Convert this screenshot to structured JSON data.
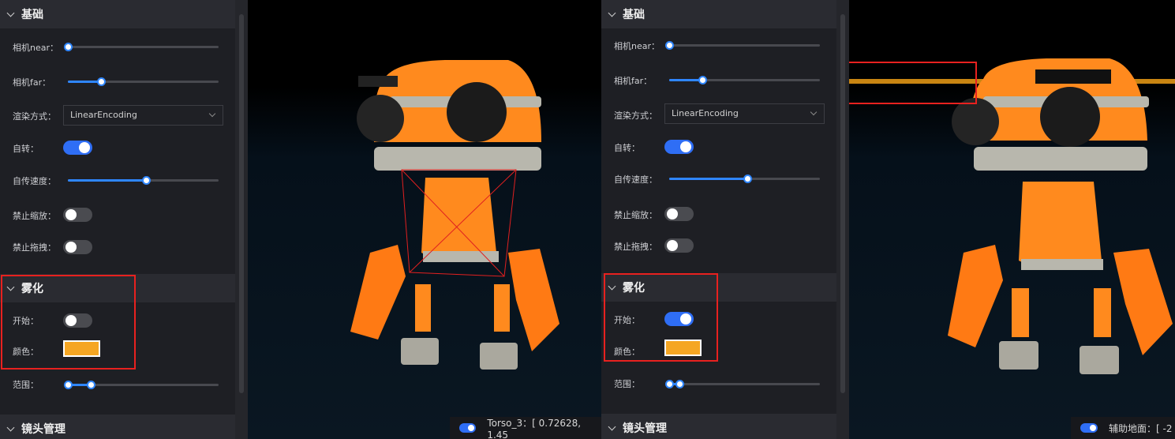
{
  "colors": {
    "accent": "#2f86ff",
    "fog": "#f5a623",
    "highlight": "#e8211f",
    "robot": "#ff8a1e"
  },
  "left": {
    "sections": {
      "basic": "基础",
      "fog": "雾化",
      "camera": "镜头管理"
    },
    "labels": {
      "near": "相机near：",
      "far": "相机far：",
      "render": "渲染方式：",
      "rotate": "自转：",
      "speed": "自传速度：",
      "zoom": "禁止缩放：",
      "drag": "禁止拖拽：",
      "fogStart": "开始：",
      "fogColor": "颜色：",
      "fogRange": "范围："
    },
    "render_value": "LinearEncoding",
    "sliders": {
      "near": 0.0,
      "far": 0.22,
      "speed": 0.52,
      "range": [
        0.0,
        0.15
      ]
    },
    "toggles": {
      "rotate": true,
      "zoom": false,
      "drag": false,
      "fogStart": false
    },
    "status": "Torso_3：[ 0.72628, 1.45"
  },
  "right": {
    "sections": {
      "basic": "基础",
      "fog": "雾化",
      "camera": "镜头管理"
    },
    "labels": {
      "near": "相机near：",
      "far": "相机far：",
      "render": "渲染方式：",
      "rotate": "自转：",
      "speed": "自传速度：",
      "zoom": "禁止缩放：",
      "drag": "禁止拖拽：",
      "fogStart": "开始：",
      "fogColor": "颜色：",
      "fogRange": "范围："
    },
    "render_value": "LinearEncoding",
    "sliders": {
      "near": 0.0,
      "far": 0.22,
      "speed": 0.52,
      "range": [
        0.0,
        0.07
      ]
    },
    "toggles": {
      "rotate": true,
      "zoom": false,
      "drag": false,
      "fogStart": true
    },
    "status": "辅助地面：[ -2"
  }
}
